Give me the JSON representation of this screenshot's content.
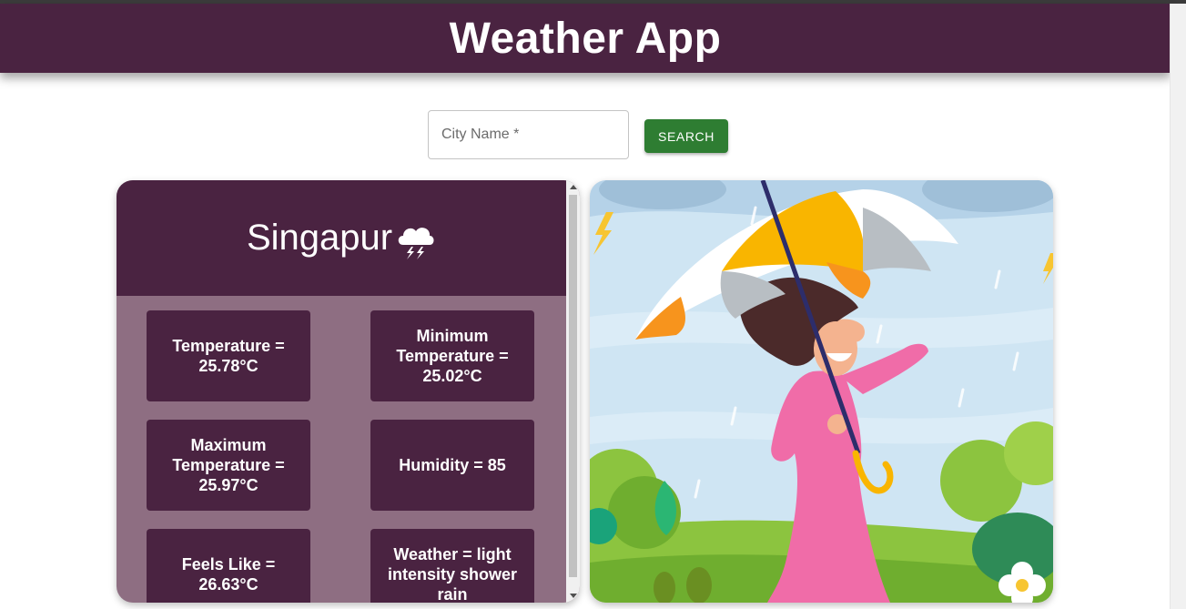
{
  "app": {
    "title": "Weather App"
  },
  "search": {
    "placeholder": "City Name *",
    "value": "",
    "button_label": "SEARCH"
  },
  "weather": {
    "city": "Singapur",
    "icon": "thunderstorm-cloud-icon",
    "stats": {
      "temperature": "Temperature = 25.78°C",
      "min_temperature": "Minimum Temperature = 25.02°C",
      "max_temperature": "Maximum Temperature = 25.97°C",
      "humidity": "Humidity = 85",
      "feels_like": "Feels Like = 26.63°C",
      "description": "Weather = light intensity shower rain"
    }
  },
  "illustration": {
    "icon": "woman-with-umbrella-in-rain-illustration"
  },
  "colors": {
    "primary": "#4a2341",
    "panel": "#8e6e82",
    "button": "#2e7d32"
  }
}
